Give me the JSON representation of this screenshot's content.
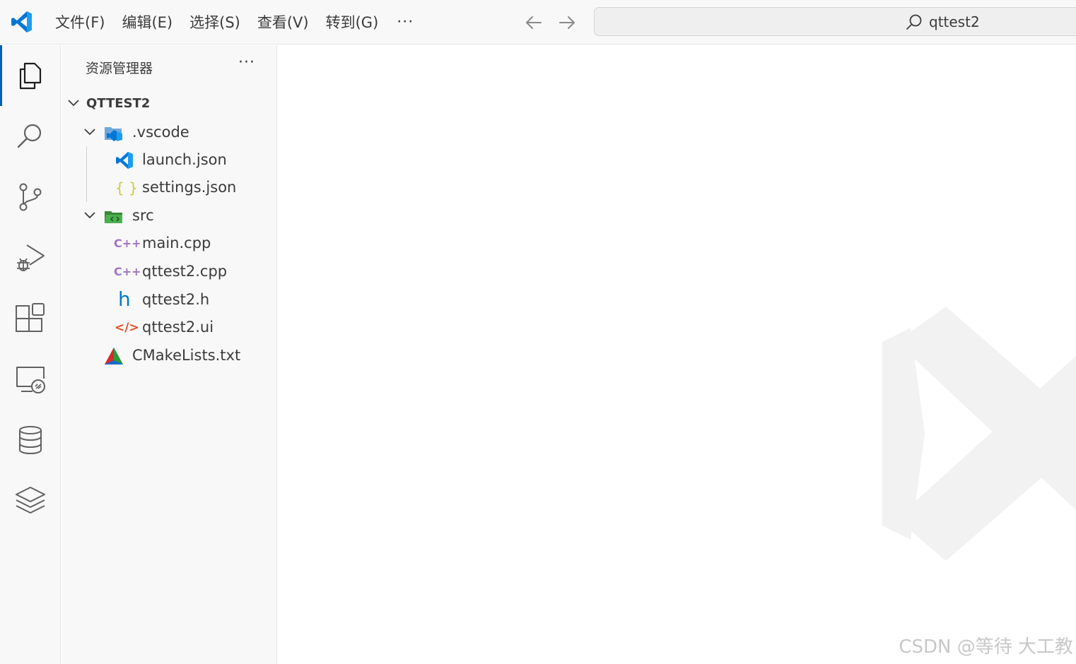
{
  "menu": {
    "items": [
      "文件(F)",
      "编辑(E)",
      "选择(S)",
      "查看(V)",
      "转到(G)"
    ],
    "more": "···"
  },
  "command_center": {
    "label": "qttest2",
    "icon": "search-icon"
  },
  "activity_bar": {
    "items": [
      {
        "name": "explorer",
        "icon": "files-icon",
        "active": true
      },
      {
        "name": "search",
        "icon": "search-icon"
      },
      {
        "name": "source-control",
        "icon": "source-control-icon"
      },
      {
        "name": "run-debug",
        "icon": "run-debug-icon"
      },
      {
        "name": "extensions",
        "icon": "extensions-icon"
      },
      {
        "name": "remote-explorer",
        "icon": "remote-explorer-icon"
      },
      {
        "name": "database",
        "icon": "database-icon"
      },
      {
        "name": "layers",
        "icon": "layers-icon"
      }
    ]
  },
  "sidebar": {
    "title": "资源管理器",
    "more": "···",
    "root": "QTTEST2",
    "tree": [
      {
        "label": ".vscode",
        "type": "folder",
        "icon": "vscode-folder-icon"
      },
      {
        "label": "launch.json",
        "type": "file",
        "icon": "vscode-icon"
      },
      {
        "label": "settings.json",
        "type": "file",
        "icon": "json-braces-icon",
        "glyph": "{ }"
      },
      {
        "label": "src",
        "type": "folder",
        "icon": "src-folder-icon"
      },
      {
        "label": "main.cpp",
        "type": "file",
        "icon": "cpp-icon",
        "glyph": "C++"
      },
      {
        "label": "qttest2.cpp",
        "type": "file",
        "icon": "cpp-icon",
        "glyph": "C++"
      },
      {
        "label": "qttest2.h",
        "type": "file",
        "icon": "header-icon",
        "glyph": "h"
      },
      {
        "label": "qttest2.ui",
        "type": "file",
        "icon": "xml-icon",
        "glyph": "</>"
      },
      {
        "label": "CMakeLists.txt",
        "type": "file",
        "icon": "cmake-icon"
      }
    ]
  },
  "watermark_text": "CSDN @等待 大工教",
  "colors": {
    "accent": "#005fb8",
    "vscode_blue": "#0078d4",
    "cpp_purple": "#a074c4",
    "header_blue": "#007acc",
    "xml_orange": "#e44d26",
    "json_yellow": "#cbcb41",
    "folder_green": "#388a34"
  }
}
